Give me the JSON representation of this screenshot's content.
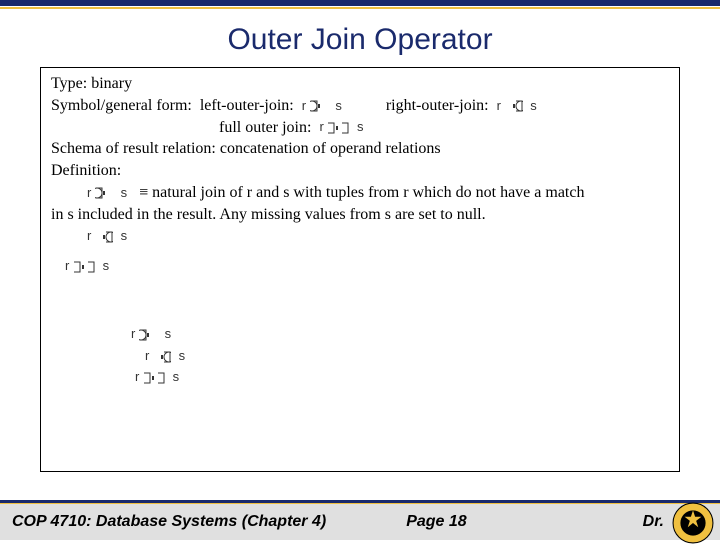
{
  "title": "Outer Join Operator",
  "body": {
    "type_label": "Type:",
    "type_value": "binary",
    "form_label": "Symbol/general form:",
    "left_label": "left-outer-join:",
    "right_label": "right-outer-join:",
    "full_label": "full outer join:",
    "schema": "Schema of result relation: concatenation of operand relations",
    "definition_label": "Definition:",
    "equiv": "≡",
    "def_text1": "natural join of r and s with tuples from r which do not have a match",
    "def_text2": "in s included in the result.  Any missing values from s are set to null."
  },
  "symbols": {
    "r": "r",
    "s": "s"
  },
  "footer": {
    "course": "COP 4710: Database Systems  (Chapter 4)",
    "page": "Page 18",
    "author": "Dr."
  }
}
